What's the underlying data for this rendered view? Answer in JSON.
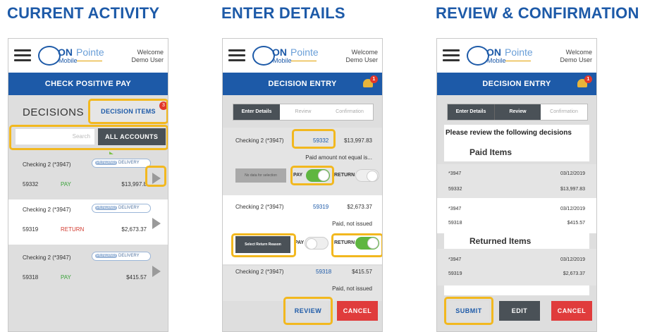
{
  "sections": {
    "current_activity": "CURRENT ACTIVITY",
    "enter_details": "ENTER DETAILS",
    "review_confirmation": "REVIEW & CONFIRMATION"
  },
  "app": {
    "logo_on": "ON",
    "logo_pointe": "Pointe",
    "logo_mobile": "Mobile",
    "welcome_line1": "Welcome",
    "welcome_line2": "Demo User"
  },
  "screen1": {
    "title": "CHECK POSITIVE PAY",
    "decisions_label": "DECISIONS",
    "decision_items_label": "DECISION ITEMS",
    "decision_items_badge": "3",
    "search_placeholder": "Search",
    "all_accounts_label": "ALL ACCOUNTS",
    "rows": [
      {
        "account": "Checking 2 (*3947)",
        "pending_a": "PENDING",
        "pending_b": "DELIVERY",
        "number": "59332",
        "status": "PAY",
        "amount": "$13,997.8"
      },
      {
        "account": "Checking 2 (*3947)",
        "pending_a": "PENDING",
        "pending_b": "DELIVERY",
        "number": "59319",
        "status": "RETURN",
        "amount": "$2,673.37"
      },
      {
        "account": "Checking 2 (*3947)",
        "pending_a": "PENDING",
        "pending_b": "DELIVERY",
        "number": "59318",
        "status": "PAY",
        "amount": "$415.57"
      }
    ]
  },
  "screen2": {
    "title": "DECISION ENTRY",
    "bell_badge": "1",
    "steps": [
      "Enter Details",
      "Review",
      "Confirmation"
    ],
    "items": [
      {
        "account": "Checking 2 (*3947)",
        "number": "59332",
        "amount": "$13,997.83",
        "note": "Paid amount not equal is..."
      },
      {
        "account": "Checking 2 (*3947)",
        "number": "59319",
        "amount": "$2,673.37",
        "note": "Paid, not issued"
      },
      {
        "account": "Checking 2 (*3947)",
        "number": "59318",
        "amount": "$415.57",
        "note": "Paid, not issued"
      }
    ],
    "no_data_label": "No data for selection",
    "pay_label": "PAY",
    "return_label": "RETURN",
    "select_return_reason": "Select Return Reason",
    "review_button": "REVIEW",
    "cancel_button": "CANCEL"
  },
  "screen3": {
    "title": "DECISION ENTRY",
    "bell_badge": "1",
    "steps": [
      "Enter Details",
      "Review",
      "Confirmation"
    ],
    "heading": "Please review the following decisions",
    "paid_items_label": "Paid Items",
    "returned_items_label": "Returned Items",
    "paid": [
      {
        "account": "*3947",
        "date": "03/12/2019",
        "number": "59332",
        "amount": "$13,997.83"
      },
      {
        "account": "*3947",
        "date": "03/12/2019",
        "number": "59318",
        "amount": "$415.57"
      }
    ],
    "returned": [
      {
        "account": "*3947",
        "date": "03/12/2019",
        "number": "59319",
        "amount": "$2,673.37"
      }
    ],
    "submit_button": "SUBMIT",
    "edit_button": "EDIT",
    "cancel_button": "CANCEL"
  },
  "colors": {
    "brand_blue": "#1d5aa8",
    "highlight": "#f2b81f",
    "pay_green": "#3ca33c",
    "return_red": "#d23b30"
  }
}
